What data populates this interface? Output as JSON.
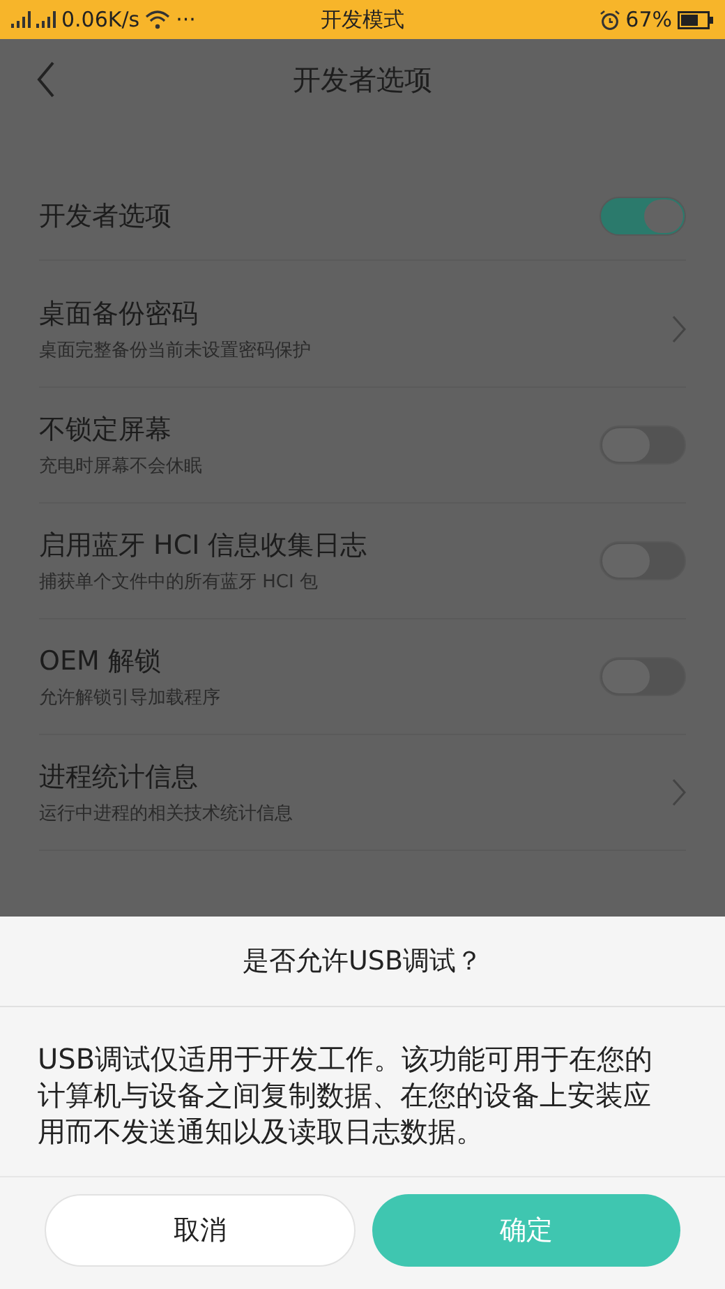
{
  "status_bar": {
    "network_speed": "0.06K/s",
    "more": "···",
    "mode": "开发模式",
    "battery_percent": "67%"
  },
  "header": {
    "title": "开发者选项"
  },
  "settings": [
    {
      "kind": "toggle",
      "title": "开发者选项",
      "on": true
    },
    {
      "kind": "link",
      "title": "桌面备份密码",
      "subtitle": "桌面完整备份当前未设置密码保护"
    },
    {
      "kind": "toggle",
      "title": "不锁定屏幕",
      "subtitle": "充电时屏幕不会休眠",
      "on": false
    },
    {
      "kind": "toggle",
      "title": "启用蓝牙 HCI 信息收集日志",
      "subtitle": "捕获单个文件中的所有蓝牙 HCI 包",
      "on": false
    },
    {
      "kind": "toggle",
      "title": "OEM 解锁",
      "subtitle": "允许解锁引导加载程序",
      "on": false
    },
    {
      "kind": "link",
      "title": "进程统计信息",
      "subtitle": "运行中进程的相关技术统计信息"
    }
  ],
  "dialog": {
    "title": "是否允许USB调试？",
    "message": "USB调试仅适用于开发工作。该功能可用于在您的计算机与设备之间复制数据、在您的设备上安装应用而不发送通知以及读取日志数据。",
    "buttons": [
      {
        "kind": "cancel",
        "label": "取消"
      },
      {
        "kind": "confirm",
        "label": "确定"
      }
    ]
  }
}
